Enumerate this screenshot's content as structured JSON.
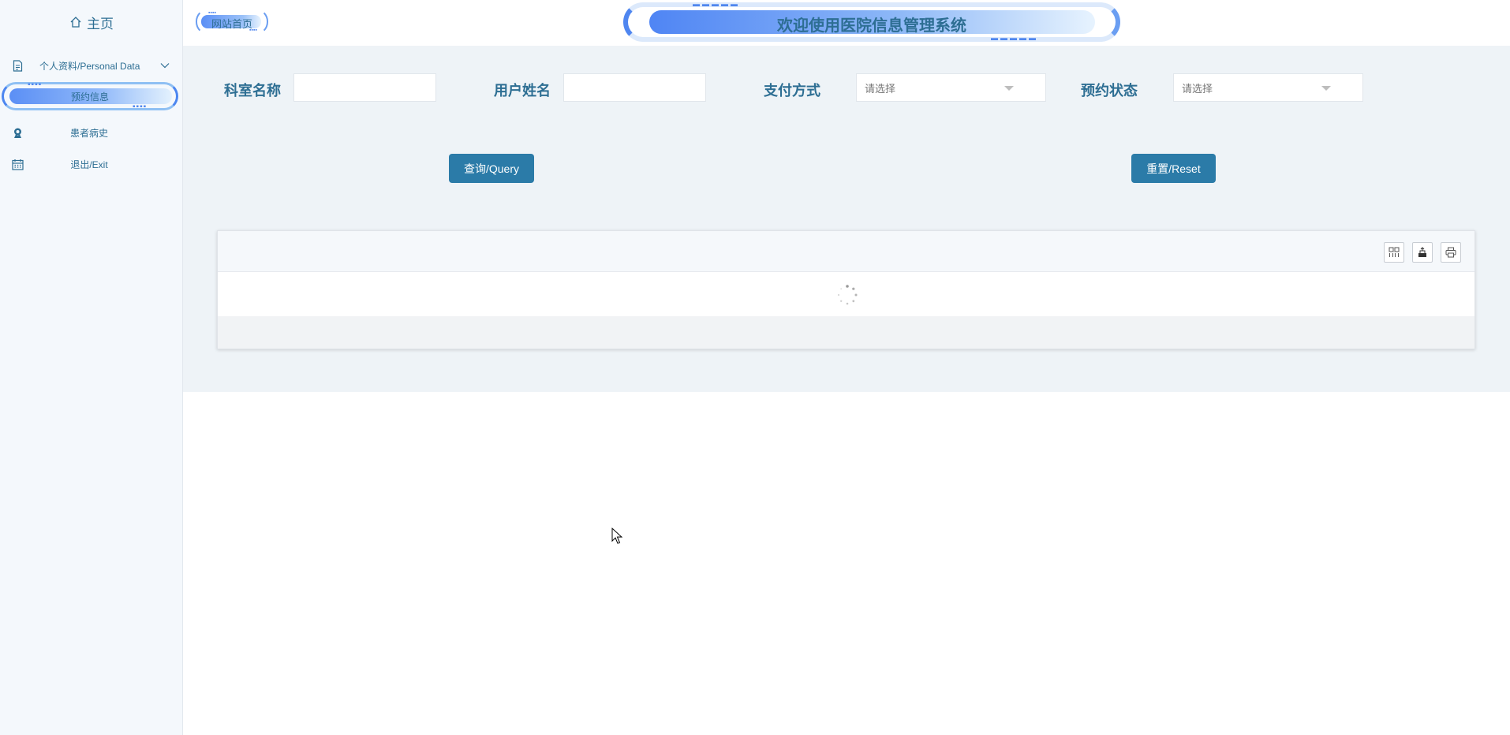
{
  "sidebar": {
    "home_label": "主页",
    "items": [
      {
        "label": "个人资料/Personal Data",
        "icon": "document-icon"
      },
      {
        "label": "预约信息",
        "active": true
      },
      {
        "label": "患者病史",
        "icon": "user-badge-icon"
      },
      {
        "label": "退出/Exit",
        "icon": "calendar-icon"
      }
    ]
  },
  "header": {
    "site_home_label": "网站首页",
    "title": "欢迎使用医院信息管理系统"
  },
  "search": {
    "department_label": "科室名称",
    "department_value": "",
    "username_label": "用户姓名",
    "username_value": "",
    "payment_label": "支付方式",
    "payment_placeholder": "请选择",
    "status_label": "预约状态",
    "status_placeholder": "请选择",
    "query_button": "查询/Query",
    "reset_button": "重置/Reset"
  },
  "table": {
    "tools": [
      "columns-icon",
      "export-icon",
      "print-icon"
    ],
    "loading": true
  },
  "colors": {
    "primary": "#2b7ba8",
    "label_text": "#2d6e93",
    "sidebar_bg": "#f4f8fc",
    "main_bg": "#eef3f7",
    "accent_blue": "#4f86f0"
  }
}
